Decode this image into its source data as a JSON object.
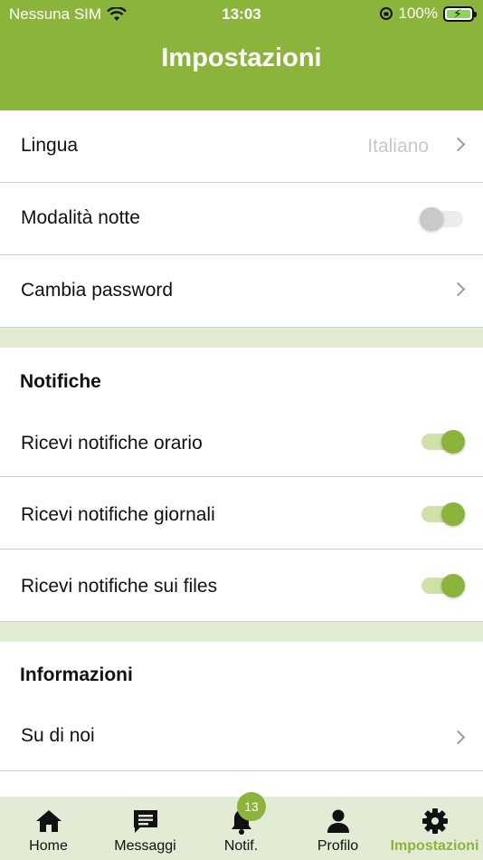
{
  "status_bar": {
    "carrier": "Nessuna SIM",
    "time": "13:03",
    "battery_percent": "100%"
  },
  "header": {
    "title": "Impostazioni"
  },
  "settings": {
    "language": {
      "label": "Lingua",
      "value": "Italiano"
    },
    "night_mode": {
      "label": "Modalità notte",
      "enabled": false
    },
    "change_password": {
      "label": "Cambia password"
    }
  },
  "notifications": {
    "heading": "Notifiche",
    "items": [
      {
        "label": "Ricevi notifiche orario",
        "enabled": true
      },
      {
        "label": "Ricevi notifiche giornali",
        "enabled": true
      },
      {
        "label": "Ricevi notifiche sui files",
        "enabled": true
      }
    ]
  },
  "info": {
    "heading": "Informazioni",
    "items": [
      {
        "label": "Su di noi"
      }
    ]
  },
  "tabbar": {
    "tabs": [
      {
        "label": "Home",
        "icon": "home-icon"
      },
      {
        "label": "Messaggi",
        "icon": "message-icon"
      },
      {
        "label": "Notif.",
        "icon": "bell-icon",
        "badge": "13"
      },
      {
        "label": "Profilo",
        "icon": "person-icon"
      },
      {
        "label": "Impostazioni",
        "icon": "gear-icon",
        "active": true
      }
    ]
  },
  "colors": {
    "accent": "#8bb53a",
    "separator_band": "#e2ebd3",
    "placeholder_text": "#c8c8c8"
  }
}
